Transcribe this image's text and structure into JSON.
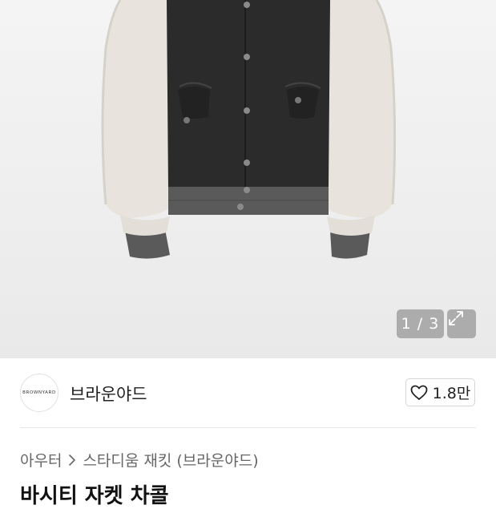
{
  "gallery": {
    "counter": "1 / 3",
    "image_alt": "varsity jacket product photo"
  },
  "store": {
    "logo_text": "BROWNYARD",
    "name": "브라운야드",
    "likes": "1.8만"
  },
  "breadcrumb": {
    "category": "아우터",
    "subcategory": "스타디움 재킷 (브라운야드)"
  },
  "product": {
    "title": "바시티 자켓 차콜"
  }
}
